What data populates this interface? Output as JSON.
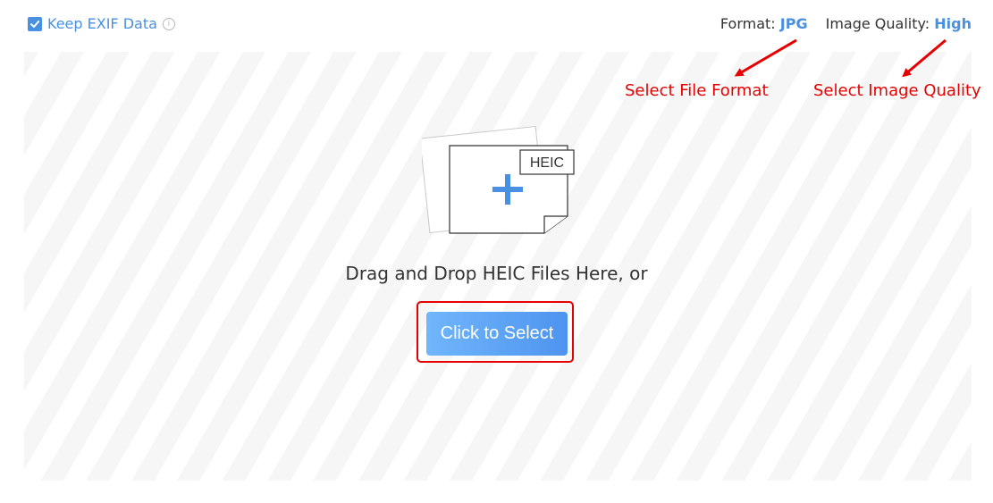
{
  "exif": {
    "label": "Keep EXIF Data",
    "checked": true,
    "info_icon": "info-icon"
  },
  "settings": {
    "format_key": "Format:",
    "format_value": "JPG",
    "quality_key": "Image Quality:",
    "quality_value": "High"
  },
  "annotations": {
    "format": "Select File Format",
    "quality": "Select Image Quality"
  },
  "dropzone": {
    "badge": "HEIC",
    "text": "Drag and Drop HEIC Files Here, or",
    "button_label": "Click to Select"
  },
  "colors": {
    "accent": "#4a90e2",
    "annotation": "#e60000",
    "button_start": "#70b6fb",
    "button_end": "#4e94ef"
  }
}
